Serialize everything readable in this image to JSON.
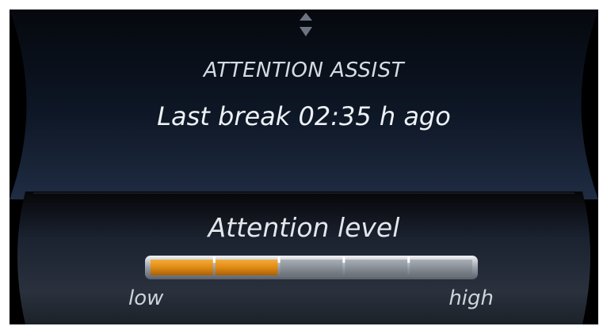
{
  "header": {
    "title": "ATTENTION ASSIST",
    "last_break": "Last break 02:35 h ago",
    "scroll_icon": "scroll-up-down-icon"
  },
  "attention": {
    "title": "Attention level",
    "low_label": "low",
    "high_label": "high",
    "segments_total": 5,
    "segments_filled": 2,
    "level_fraction": 0.4
  },
  "colors": {
    "fill": "#e08a14",
    "empty": "#8e949c",
    "panel": "#1a2638",
    "text": "#e8ebef"
  }
}
